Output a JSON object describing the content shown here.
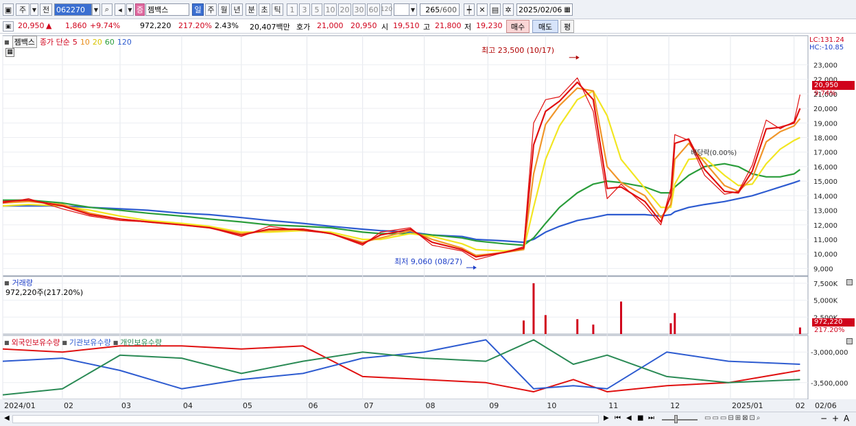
{
  "toolbar": {
    "code_prefix": "주",
    "period_prefix": "전",
    "stock_code": "062270",
    "stock_badge": "증",
    "stock_name": "젬백스",
    "period_buttons": [
      "일",
      "주",
      "월",
      "년",
      "분",
      "초",
      "틱"
    ],
    "selected_period": "일",
    "minute_buttons": [
      "1",
      "3",
      "5",
      "10",
      "20",
      "30",
      "60",
      "120"
    ],
    "count_value": "265",
    "count_total": "/600",
    "date_value": "2025/02/06"
  },
  "quote": {
    "price": "20,950",
    "direction": "▲",
    "change": "1,860",
    "change_pct": "+9.74%",
    "volume": "972,220",
    "volume_ratio": "217.20%",
    "turnover": "2.43%",
    "amount": "20,407백만",
    "hoga_label": "호가",
    "ask": "21,000",
    "bid": "20,950",
    "open_label": "시",
    "open": "19,510",
    "high_label": "고",
    "high": "21,800",
    "low_label": "저",
    "low": "19,230",
    "buy_label": "매수",
    "sell_label": "매도",
    "avg_label": "평"
  },
  "price_pane": {
    "name_tag": "젬백스",
    "legend_prefix": "종가 단순",
    "legend_periods": [
      "5",
      "10",
      "20",
      "60",
      "120"
    ],
    "lc_label": "LC:131.24",
    "hc_label": "HC:-10.85",
    "high_annotation": "최고 23,500 (10/17)",
    "low_annotation": "최저 9,060 (08/27)",
    "dividend_annotation": "배당락(0.00%)",
    "last_price_label": "20,950",
    "last_pct_label": "9.74%"
  },
  "volume_pane": {
    "title": "거래량",
    "value_text": "972,220주(217.20%)",
    "last_label": "972,220",
    "last_pct_label": "217.20%"
  },
  "holdings_pane": {
    "legend": [
      "외국인보유수량",
      "기관보유수량",
      "개인보유수량"
    ]
  },
  "x_axis_labels": [
    "2024/01",
    "02",
    "03",
    "04",
    "05",
    "06",
    "07",
    "08",
    "09",
    "10",
    "11",
    "12",
    "2025/01",
    "02",
    "02/06"
  ],
  "chart_data": [
    {
      "type": "line",
      "name": "price",
      "ylim": [
        8500,
        25000
      ],
      "y_ticks": [
        9000,
        10000,
        11000,
        12000,
        13000,
        14000,
        15000,
        16000,
        17000,
        18000,
        19000,
        20000,
        21000,
        22000,
        23000
      ],
      "y_tick_labels": [
        "9,000",
        "10,000",
        "11,000",
        "12,000",
        "13,000",
        "14,000",
        "15,000",
        "16,000",
        "17,000",
        "18,000",
        "19,000",
        "20,000",
        "21,000",
        "22,000",
        "23,000"
      ],
      "x": [
        "2024-01-02",
        "2024-01-15",
        "2024-02-01",
        "2024-02-15",
        "2024-03-01",
        "2024-03-15",
        "2024-04-01",
        "2024-04-15",
        "2024-05-01",
        "2024-05-15",
        "2024-06-01",
        "2024-06-15",
        "2024-07-01",
        "2024-07-10",
        "2024-07-25",
        "2024-08-05",
        "2024-08-20",
        "2024-08-27",
        "2024-09-10",
        "2024-09-20",
        "2024-09-25",
        "2024-10-01",
        "2024-10-08",
        "2024-10-17",
        "2024-10-25",
        "2024-11-01",
        "2024-11-08",
        "2024-11-20",
        "2024-11-28",
        "2024-12-03",
        "2024-12-05",
        "2024-12-12",
        "2024-12-20",
        "2024-12-30",
        "2025-01-06",
        "2025-01-13",
        "2025-01-20",
        "2025-01-27",
        "2025-02-03",
        "2025-02-06"
      ],
      "series": [
        {
          "name": "종가",
          "color": "#e01010",
          "values": [
            13500,
            13800,
            13100,
            12600,
            12300,
            12200,
            12000,
            11800,
            11200,
            11900,
            11600,
            11400,
            10600,
            11500,
            11800,
            10600,
            10200,
            9600,
            10100,
            10500,
            19000,
            20600,
            20800,
            22100,
            19800,
            13800,
            14800,
            13300,
            12000,
            14500,
            18200,
            17800,
            15400,
            14100,
            14300,
            16100,
            19200,
            18600,
            19100,
            20950
          ]
        },
        {
          "name": "5",
          "color": "#e01010",
          "values": [
            13600,
            13700,
            13300,
            12700,
            12400,
            12200,
            12000,
            11800,
            11300,
            11700,
            11700,
            11400,
            10700,
            11300,
            11700,
            10800,
            10300,
            9800,
            10100,
            10400,
            17500,
            19800,
            20500,
            21800,
            20600,
            14500,
            14600,
            13600,
            12200,
            14000,
            17600,
            17900,
            15800,
            14300,
            14200,
            15700,
            18600,
            18700,
            19000,
            20000
          ]
        },
        {
          "name": "10",
          "color": "#f0962a",
          "values": [
            13500,
            13600,
            13400,
            12800,
            12400,
            12200,
            12000,
            11800,
            11400,
            11600,
            11700,
            11400,
            10800,
            11100,
            11600,
            11000,
            10400,
            9900,
            10100,
            10300,
            15500,
            18900,
            20200,
            21400,
            21200,
            16000,
            14900,
            14000,
            12500,
            13400,
            16500,
            17600,
            16300,
            14700,
            14300,
            15200,
            17700,
            18400,
            18800,
            19300
          ]
        },
        {
          "name": "20",
          "color": "#f2e622",
          "values": [
            13300,
            13400,
            13300,
            13000,
            12600,
            12300,
            12100,
            11900,
            11500,
            11500,
            11600,
            11500,
            11000,
            11000,
            11400,
            11200,
            10700,
            10300,
            10200,
            10300,
            13200,
            16500,
            18800,
            20600,
            21200,
            19500,
            16500,
            14500,
            13200,
            13200,
            14800,
            16500,
            16600,
            15400,
            14700,
            14800,
            16200,
            17200,
            17800,
            18000
          ]
        },
        {
          "name": "60",
          "color": "#2a9d3a",
          "values": [
            13700,
            13700,
            13500,
            13200,
            13000,
            12800,
            12600,
            12400,
            12200,
            12000,
            11900,
            11800,
            11500,
            11400,
            11400,
            11300,
            11100,
            10900,
            10700,
            10600,
            11100,
            12100,
            13200,
            14200,
            14800,
            15000,
            14900,
            14600,
            14200,
            14200,
            14600,
            15400,
            16000,
            16200,
            16000,
            15500,
            15300,
            15300,
            15500,
            15800
          ]
        },
        {
          "name": "120",
          "color": "#2d5bd0",
          "values": [
            13300,
            13300,
            13300,
            13200,
            13100,
            13000,
            12800,
            12700,
            12500,
            12300,
            12100,
            11900,
            11700,
            11600,
            11500,
            11300,
            11200,
            11000,
            10900,
            10800,
            11000,
            11500,
            11900,
            12300,
            12500,
            12700,
            12700,
            12700,
            12600,
            12700,
            12900,
            13200,
            13400,
            13600,
            13800,
            14000,
            14300,
            14600,
            14900,
            15050
          ]
        }
      ],
      "high": {
        "value": 23500,
        "date": "10/17"
      },
      "low": {
        "value": 9060,
        "date": "08/27"
      }
    },
    {
      "type": "bar",
      "name": "volume",
      "ylim": [
        0,
        8500000
      ],
      "y_ticks": [
        2500000,
        5000000,
        7500000
      ],
      "y_tick_labels": [
        "2,500K",
        "5,000K",
        "7,500K"
      ],
      "x": [
        "2024-09-20",
        "2024-09-25",
        "2024-10-01",
        "2024-10-17",
        "2024-10-25",
        "2024-11-08",
        "2024-12-03",
        "2024-12-05",
        "2025-02-06"
      ],
      "values": [
        2000000,
        7500000,
        2800000,
        2200000,
        1400000,
        4800000,
        1600000,
        3100000,
        972220
      ]
    },
    {
      "type": "line",
      "name": "holdings",
      "y_ticks": [
        -3000000,
        -3500000
      ],
      "y_tick_labels": [
        "-3,000,000",
        "-3,500,000"
      ],
      "x": [
        "2024-01-02",
        "2024-02-01",
        "2024-03-01",
        "2024-04-01",
        "2024-05-01",
        "2024-06-01",
        "2024-07-01",
        "2024-08-01",
        "2024-09-01",
        "2024-09-25",
        "2024-10-15",
        "2024-11-01",
        "2024-12-01",
        "2025-01-01",
        "2025-02-06"
      ],
      "series": [
        {
          "name": "외국인보유수량",
          "color": "#e01010",
          "values": [
            -2950000,
            -3000000,
            -2900000,
            -2900000,
            -2950000,
            -2900000,
            -3400000,
            -3450000,
            -3500000,
            -3650000,
            -3450000,
            -3650000,
            -3550000,
            -3500000,
            -3300000
          ]
        },
        {
          "name": "기관보유수량",
          "color": "#2d5bd0",
          "values": [
            -3150000,
            -3100000,
            -3300000,
            -3600000,
            -3450000,
            -3350000,
            -3100000,
            -3000000,
            -2800000,
            -3600000,
            -3550000,
            -3600000,
            -3000000,
            -3150000,
            -3200000
          ]
        },
        {
          "name": "개인보유수량",
          "color": "#2a8a55",
          "values": [
            -3700000,
            -3600000,
            -3050000,
            -3100000,
            -3350000,
            -3150000,
            -3000000,
            -3100000,
            -3150000,
            -2800000,
            -3200000,
            -3050000,
            -3400000,
            -3500000,
            -3450000
          ]
        }
      ]
    }
  ]
}
